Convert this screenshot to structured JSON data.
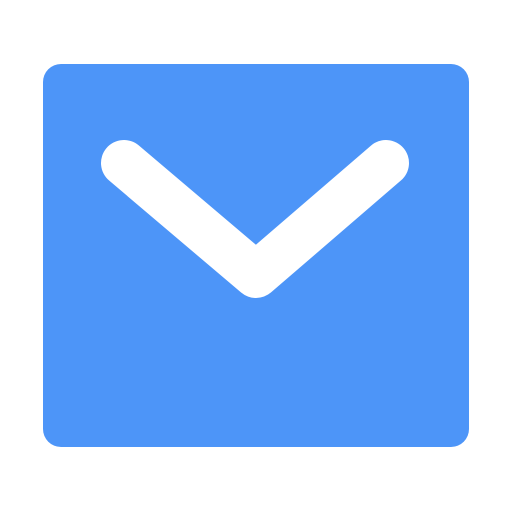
{
  "icon": {
    "name": "mail-icon",
    "background_color": "#ffffff",
    "envelope_color": "#4d95f8",
    "flap_color": "#ffffff"
  }
}
